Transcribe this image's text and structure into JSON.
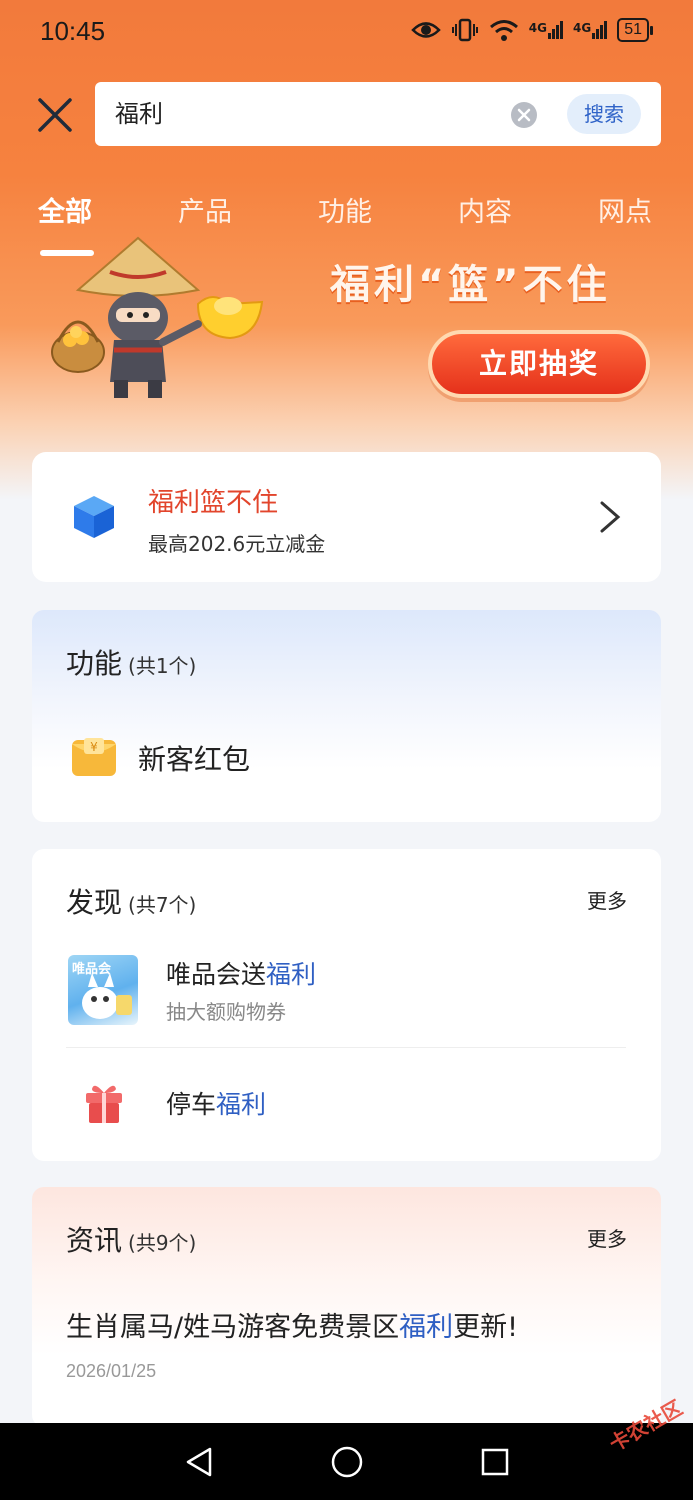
{
  "status_bar": {
    "time": "10:45",
    "network": "4G",
    "network2": "4G",
    "battery": "51"
  },
  "search": {
    "query": "福利",
    "button_label": "搜索"
  },
  "tabs": [
    {
      "label": "全部"
    },
    {
      "label": "产品"
    },
    {
      "label": "功能"
    },
    {
      "label": "内容"
    },
    {
      "label": "网点"
    }
  ],
  "banner": {
    "title": "福利“篮”不住",
    "cta_label": "立即抽奖"
  },
  "promo": {
    "title": "福利篮不住",
    "subtitle": "最高202.6元立减金"
  },
  "function_section": {
    "title": "功能",
    "count": "(共1个)",
    "items": [
      {
        "label": "新客红包"
      }
    ]
  },
  "discover_section": {
    "title": "发现",
    "count": "(共7个)",
    "more": "更多",
    "items": [
      {
        "thumb_label": "唯品会",
        "title_prefix": "唯品会送",
        "title_highlight": "福利",
        "subtitle": "抽大额购物券"
      },
      {
        "title_prefix": "停车",
        "title_highlight": "福利"
      }
    ]
  },
  "news_section": {
    "title": "资讯",
    "count": "(共9个)",
    "more": "更多",
    "items": [
      {
        "title_prefix": "生肖属马/姓马游客免费景区",
        "title_highlight": "福利",
        "title_suffix": "更新!",
        "date": "2026/01/25"
      }
    ]
  },
  "watermark": "卡农社区",
  "colors": {
    "accent_orange": "#f27a3c",
    "highlight_blue": "#2f5fc3",
    "promo_red": "#e2452c"
  }
}
